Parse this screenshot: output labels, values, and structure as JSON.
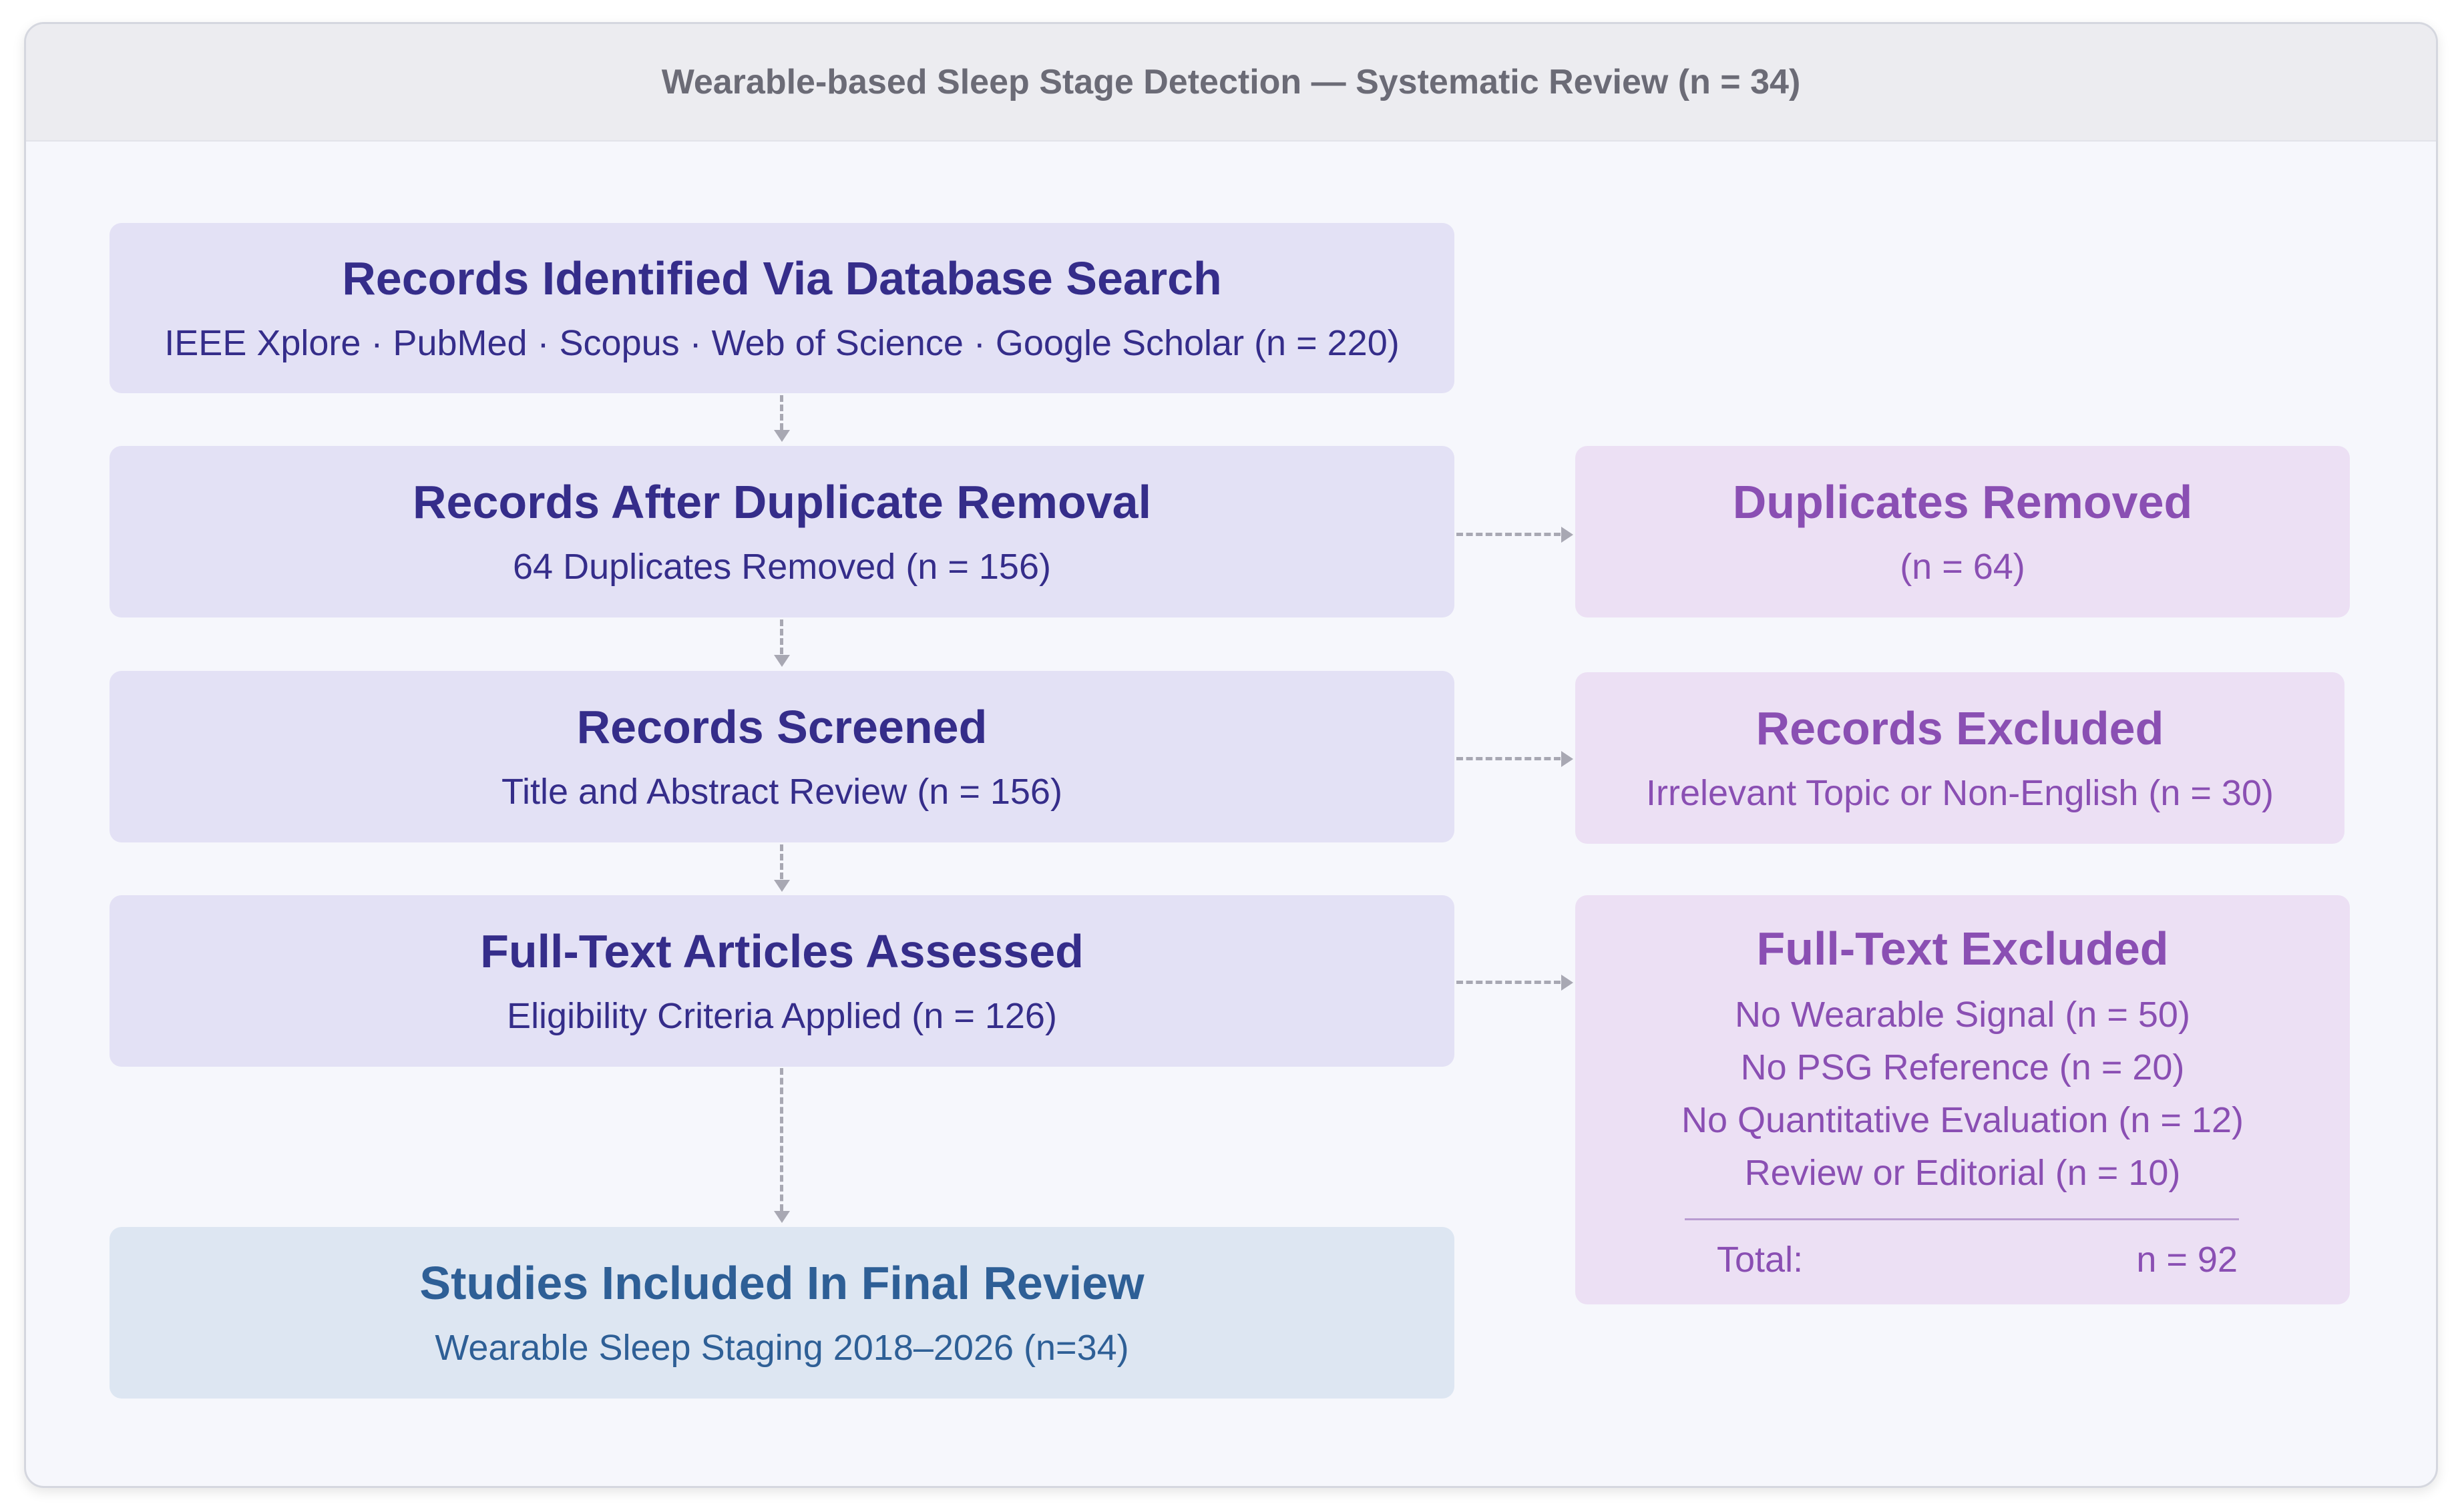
{
  "header": {
    "title": "Wearable-based Sleep Stage Detection — Systematic Review (n = 34)"
  },
  "flow": {
    "identified": {
      "title": "Records Identified Via Database Search",
      "subtitle": "IEEE Xplore · PubMed · Scopus · Web of Science · Google Scholar (n = 220)"
    },
    "dedup": {
      "title": "Records After Duplicate Removal",
      "subtitle": "64 Duplicates Removed (n = 156)"
    },
    "screened": {
      "title": "Records Screened",
      "subtitle": "Title and Abstract Review (n = 156)"
    },
    "fulltext": {
      "title": "Full-Text Articles Assessed",
      "subtitle": "Eligibility Criteria Applied (n = 126)"
    },
    "included": {
      "title": "Studies Included In Final Review",
      "subtitle": "Wearable Sleep Staging 2018–2026 (n=34)"
    }
  },
  "side": {
    "duplicates": {
      "title": "Duplicates Removed",
      "subtitle": "(n = 64)"
    },
    "excluded": {
      "title": "Records Excluded",
      "subtitle": "Irrelevant Topic or Non-English (n = 30)"
    },
    "fulltext_excluded": {
      "title": "Full-Text Excluded",
      "reasons": [
        "No Wearable Signal (n = 50)",
        "No PSG Reference (n = 20)",
        "No Quantitative Evaluation (n = 12)",
        "Review or Editorial (n = 10)"
      ],
      "total_label": "Total:",
      "total_value": "n = 92"
    }
  },
  "colors": {
    "main_box": "#e3e1f5",
    "main_text": "#352d8a",
    "final_box": "#dde6f2",
    "final_text": "#2e5f96",
    "side_box": "#ece0f4",
    "side_text": "#8a4fb3",
    "arrow": "#a8a8b3"
  }
}
